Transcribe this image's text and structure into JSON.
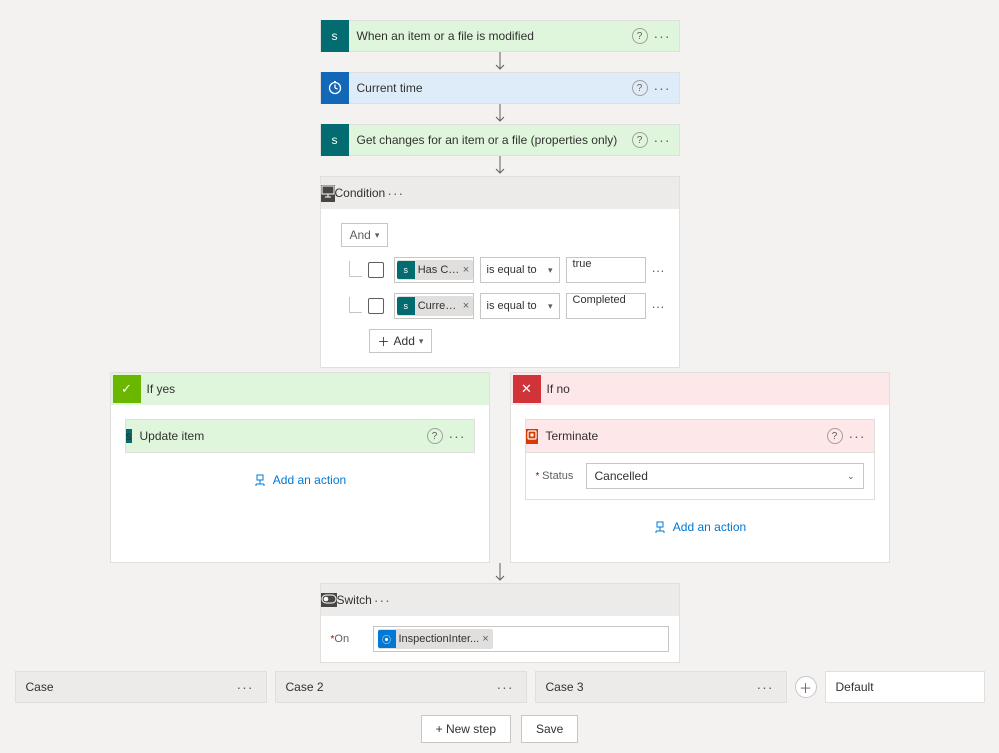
{
  "trigger": {
    "label": "When an item or a file is modified"
  },
  "currentTime": {
    "label": "Current time"
  },
  "getChanges": {
    "label": "Get changes for an item or a file (properties only)"
  },
  "condition": {
    "label": "Condition",
    "group": "And",
    "addLabel": "Add",
    "rows": [
      {
        "token": "Has Colu...",
        "operator": "is equal to",
        "value": "true"
      },
      {
        "token": "Currentl...",
        "operator": "is equal to",
        "value": "Completed"
      }
    ]
  },
  "yes": {
    "header": "If yes",
    "action": "Update item",
    "addAction": "Add an action"
  },
  "no": {
    "header": "If no",
    "action": "Terminate",
    "statusLabel": "Status",
    "statusValue": "Cancelled",
    "addAction": "Add an action"
  },
  "switch": {
    "label": "Switch",
    "onLabel": "On",
    "token": "InspectionInter..."
  },
  "cases": {
    "c1": "Case",
    "c2": "Case 2",
    "c3": "Case 3",
    "default": "Default"
  },
  "footer": {
    "newStep": "+ New step",
    "save": "Save"
  }
}
